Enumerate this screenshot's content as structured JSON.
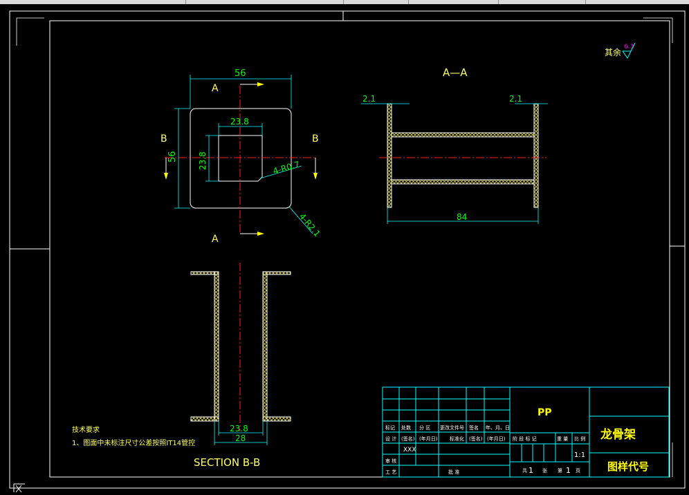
{
  "colors": {
    "background": "#000000",
    "line": "#ffffff",
    "dimension": "#00ff00",
    "cyan": "#00ffff",
    "section_label": "#ffff66",
    "center_line": "#ff2020",
    "hatch": "#d8d050",
    "magenta": "#ff00ff"
  },
  "surface_finish": {
    "label": "其余",
    "value": "6.3"
  },
  "top_view": {
    "dim_width": "56",
    "dim_height": "56",
    "inner_width": "23.8",
    "inner_height": "23.8",
    "inner_radius": "4-R0.7",
    "outer_radius": "4-R2.1",
    "section_a_top": "A",
    "section_a_bottom": "A",
    "section_b_left": "B",
    "section_b_right": "B"
  },
  "section_aa": {
    "title": "A—A",
    "dim_left_wall": "2.1",
    "dim_right_wall": "2.1",
    "dim_length": "84"
  },
  "section_bb": {
    "title": "SECTION B-B",
    "dim_inner": "23.8",
    "dim_outer": "28"
  },
  "tech_notes": {
    "heading": "技术要求",
    "line1": "1、图面中未标注尺寸公差按照IT14管控"
  },
  "title_block": {
    "material": "PP",
    "part_name": "龙骨架",
    "drawing_code_label": "图样代号",
    "header_cells": [
      "标记",
      "处数",
      "分 区",
      "更改文件号",
      "签名",
      "年、月、日"
    ],
    "row2_cells": [
      "设 计",
      "(签名)",
      "(年月日)",
      "标准化",
      "(签名)",
      "(年月日)"
    ],
    "designer": "XXX",
    "review": "审 核",
    "process": "工 艺",
    "approve": "批 准",
    "stage_headers": [
      "阶 段 标 记",
      "重 量",
      "比 例"
    ],
    "scale": "1:1",
    "sheets_total_label": "共",
    "sheets_total": "1",
    "sheets_total_unit": "张",
    "sheet_no_label": "第",
    "sheet_no": "1",
    "sheet_no_unit": "页"
  }
}
